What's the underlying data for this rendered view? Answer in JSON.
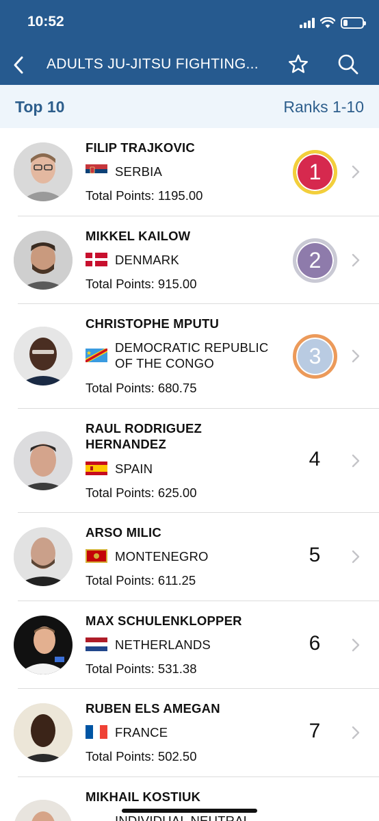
{
  "status": {
    "time": "10:52"
  },
  "nav": {
    "title": "ADULTS JU-JITSU FIGHTING..."
  },
  "subheader": {
    "left": "Top 10",
    "right": "Ranks 1-10"
  },
  "colors": {
    "header": "#265a8f",
    "gold": "#f2cf3b",
    "goldInner": "#d6294e",
    "silver": "#c9c9d4",
    "silverInner": "#8e7bab",
    "bronze": "#ec9a5a",
    "bronzeInner": "#b9cbe2"
  },
  "athletes": [
    {
      "name": "FILIP TRAJKOVIC",
      "country": "SERBIA",
      "flag": "serbia-flag",
      "points": "Total Points: 1195.00",
      "rank": "1"
    },
    {
      "name": "MIKKEL KAILOW",
      "country": "DENMARK",
      "flag": "denmark-flag",
      "points": "Total Points: 915.00",
      "rank": "2"
    },
    {
      "name": "CHRISTOPHE MPUTU",
      "country_line1": "DEMOCRATIC REPUBLIC",
      "country_line2": "OF THE CONGO",
      "flag": "dr-congo-flag",
      "points": "Total Points: 680.75",
      "rank": "3"
    },
    {
      "name_line1": "RAUL RODRIGUEZ",
      "name_line2": "HERNANDEZ",
      "country": "SPAIN",
      "flag": "spain-flag",
      "points": "Total Points: 625.00",
      "rank": "4"
    },
    {
      "name": "ARSO MILIC",
      "country": "MONTENEGRO",
      "flag": "montenegro-flag",
      "points": "Total Points: 611.25",
      "rank": "5"
    },
    {
      "name": "MAX SCHULENKLOPPER",
      "country": "NETHERLANDS",
      "flag": "netherlands-flag",
      "points": "Total Points: 531.38",
      "rank": "6"
    },
    {
      "name": "RUBEN ELS AMEGAN",
      "country": "FRANCE",
      "flag": "france-flag",
      "points": "Total Points: 502.50",
      "rank": "7"
    },
    {
      "name": "MIKHAIL KOSTIUK",
      "country": "INDIVIDUAL NEUTRAL",
      "flag": ""
    }
  ]
}
